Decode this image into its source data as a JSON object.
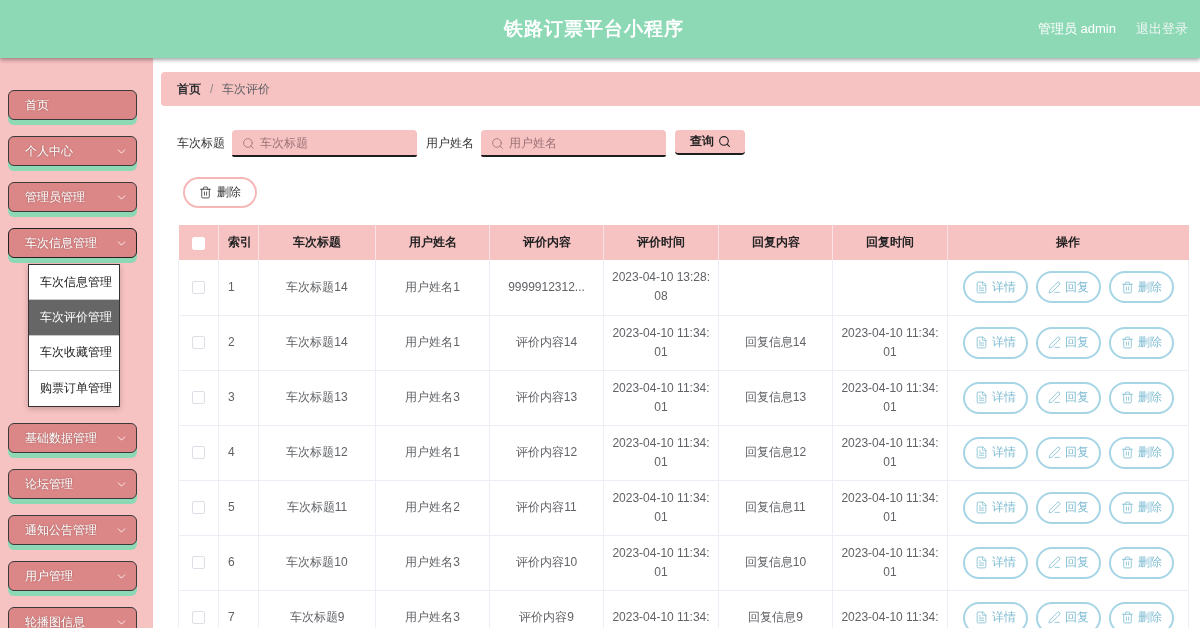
{
  "header": {
    "title": "铁路订票平台小程序",
    "user": "管理员 admin",
    "logout": "退出登录"
  },
  "sidebar": {
    "items": [
      {
        "kind": "link",
        "label": "首页"
      },
      {
        "kind": "submenu",
        "label": "个人中心",
        "expanded": false
      },
      {
        "kind": "submenu",
        "label": "管理员管理",
        "expanded": false
      },
      {
        "kind": "submenu",
        "label": "车次信息管理",
        "expanded": true,
        "children": [
          {
            "label": "车次信息管理",
            "selected": false
          },
          {
            "label": "车次评价管理",
            "selected": true
          },
          {
            "label": "车次收藏管理",
            "selected": false
          },
          {
            "label": "购票订单管理",
            "selected": false
          }
        ]
      },
      {
        "kind": "submenu",
        "label": "基础数据管理",
        "expanded": false
      },
      {
        "kind": "submenu",
        "label": "论坛管理",
        "expanded": false
      },
      {
        "kind": "submenu",
        "label": "通知公告管理",
        "expanded": false
      },
      {
        "kind": "submenu",
        "label": "用户管理",
        "expanded": false
      },
      {
        "kind": "submenu",
        "label": "轮播图信息",
        "expanded": false
      }
    ]
  },
  "breadcrumb": {
    "items": [
      "首页",
      "车次评价"
    ],
    "separator": "/"
  },
  "search": {
    "fields": [
      {
        "label": "车次标题",
        "placeholder": "车次标题"
      },
      {
        "label": "用户姓名",
        "placeholder": "用户姓名"
      }
    ],
    "button": "查询"
  },
  "toolbar": {
    "delete_button": "删除"
  },
  "table": {
    "all_checked": false,
    "columns": [
      "索引",
      "车次标题",
      "用户姓名",
      "评价内容",
      "评价时间",
      "回复内容",
      "回复时间",
      "操作"
    ],
    "rows": [
      {
        "checked": false,
        "index": "1",
        "title": "车次标题14",
        "user": "用户姓名1",
        "content": "9999912312...",
        "time": "2023-04-10 13:28:08",
        "actions": [
          {
            "kind": "detail",
            "label": "详情"
          },
          {
            "kind": "reply",
            "label": "回复"
          },
          {
            "kind": "delete",
            "label": "删除"
          }
        ]
      },
      {
        "checked": false,
        "index": "2",
        "title": "车次标题14",
        "user": "用户姓名1",
        "content": "评价内容14",
        "time": "2023-04-10 11:34:01",
        "reply": "回复信息14",
        "reply_time": "2023-04-10 11:34:01",
        "actions": [
          {
            "kind": "detail",
            "label": "详情"
          },
          {
            "kind": "reply",
            "label": "回复"
          },
          {
            "kind": "delete",
            "label": "删除"
          }
        ]
      },
      {
        "checked": false,
        "index": "3",
        "title": "车次标题13",
        "user": "用户姓名3",
        "content": "评价内容13",
        "time": "2023-04-10 11:34:01",
        "reply": "回复信息13",
        "reply_time": "2023-04-10 11:34:01",
        "actions": [
          {
            "kind": "detail",
            "label": "详情"
          },
          {
            "kind": "reply",
            "label": "回复"
          },
          {
            "kind": "delete",
            "label": "删除"
          }
        ]
      },
      {
        "checked": false,
        "index": "4",
        "title": "车次标题12",
        "user": "用户姓名1",
        "content": "评价内容12",
        "time": "2023-04-10 11:34:01",
        "reply": "回复信息12",
        "reply_time": "2023-04-10 11:34:01",
        "actions": [
          {
            "kind": "detail",
            "label": "详情"
          },
          {
            "kind": "reply",
            "label": "回复"
          },
          {
            "kind": "delete",
            "label": "删除"
          }
        ]
      },
      {
        "checked": false,
        "index": "5",
        "title": "车次标题11",
        "user": "用户姓名2",
        "content": "评价内容11",
        "time": "2023-04-10 11:34:01",
        "reply": "回复信息11",
        "reply_time": "2023-04-10 11:34:01",
        "actions": [
          {
            "kind": "detail",
            "label": "详情"
          },
          {
            "kind": "reply",
            "label": "回复"
          },
          {
            "kind": "delete",
            "label": "删除"
          }
        ]
      },
      {
        "checked": false,
        "index": "6",
        "title": "车次标题10",
        "user": "用户姓名3",
        "content": "评价内容10",
        "time": "2023-04-10 11:34:01",
        "reply": "回复信息10",
        "reply_time": "2023-04-10 11:34:01",
        "actions": [
          {
            "kind": "detail",
            "label": "详情"
          },
          {
            "kind": "reply",
            "label": "回复"
          },
          {
            "kind": "delete",
            "label": "删除"
          }
        ]
      },
      {
        "checked": false,
        "index": "7",
        "title": "车次标题9",
        "user": "用户姓名3",
        "content": "评价内容9",
        "time": "2023-04-10 11:34:",
        "reply": "回复信息9",
        "reply_time": "2023-04-10 11:34:",
        "actions": [
          {
            "kind": "detail",
            "label": "详情"
          },
          {
            "kind": "reply",
            "label": "回复"
          },
          {
            "kind": "delete",
            "label": "删除"
          }
        ]
      }
    ]
  }
}
